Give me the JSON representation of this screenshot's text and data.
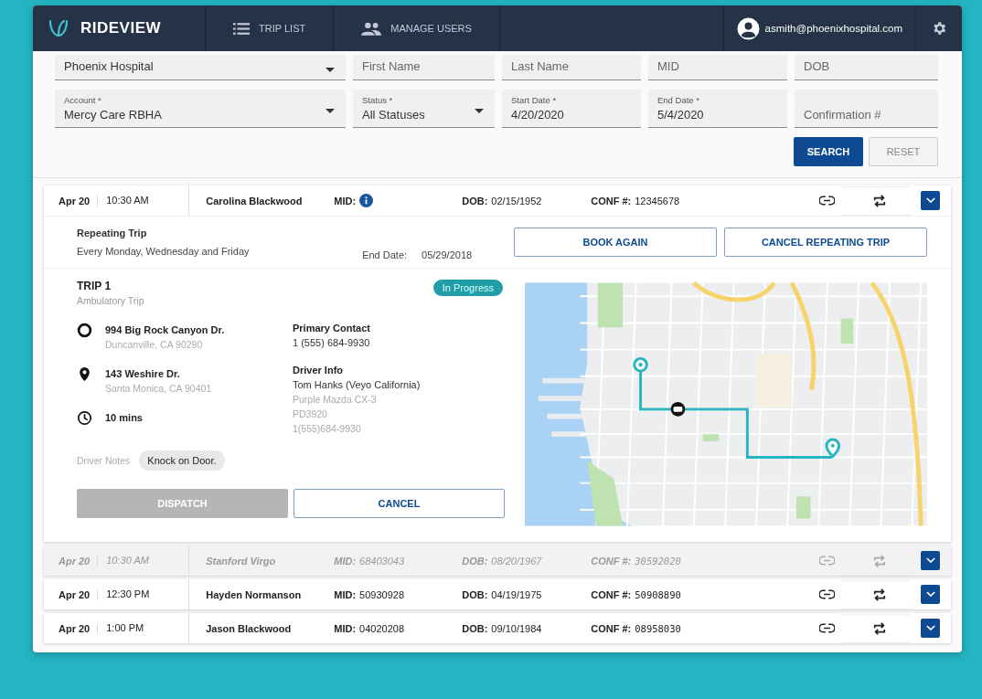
{
  "app": {
    "logo": "RIDEVIEW"
  },
  "nav": [
    {
      "label": "TRIP LIST"
    },
    {
      "label": "MANAGE USERS"
    }
  ],
  "user": {
    "email": "asmith@phoenixhospital.com"
  },
  "filters": [
    [
      {
        "kind": "select",
        "value": "Phoenix Hospital"
      },
      {
        "kind": "text",
        "placeholder": "First Name"
      },
      {
        "kind": "text",
        "placeholder": "Last Name"
      },
      {
        "kind": "text",
        "placeholder": "MID"
      },
      {
        "kind": "text",
        "placeholder": "DOB"
      }
    ],
    [
      {
        "kind": "select",
        "label": "Account *",
        "value": "Mercy Care RBHA"
      },
      {
        "kind": "select",
        "label": "Status *",
        "value": "All Statuses"
      },
      {
        "kind": "text",
        "label": "Start Date *",
        "value": "4/20/2020"
      },
      {
        "kind": "text",
        "label": "End Date *",
        "value": "5/4/2020"
      },
      {
        "kind": "text",
        "placeholder": "Confirmation #"
      }
    ]
  ],
  "filter_buttons": [
    {
      "label": "SEARCH",
      "disabled": false
    },
    {
      "label": "RESET",
      "disabled": true
    }
  ],
  "trips": [
    {
      "date": "Apr 20",
      "time": "10:30 AM",
      "name": "Carolina Blackwood",
      "disabled": false,
      "fields": [
        {
          "kind": "info",
          "label": "MID:"
        },
        {
          "kind": "text",
          "label": "DOB:",
          "value": "02/15/1952"
        },
        {
          "kind": "text",
          "label": "CONF #:",
          "value": "12345678"
        }
      ]
    },
    {
      "date": "Apr 20",
      "time": "10:30 AM",
      "name": "Stanford Virgo",
      "disabled": true,
      "fields": [
        {
          "kind": "text",
          "label": "MID:",
          "value": "68403043"
        },
        {
          "kind": "text",
          "label": "DOB:",
          "value": "08/20/1967"
        },
        {
          "kind": "code",
          "label": "CONF #:",
          "value": "30592020"
        }
      ]
    },
    {
      "date": "Apr 20",
      "time": "12:30 PM",
      "name": "Hayden Normanson",
      "disabled": false,
      "fields": [
        {
          "kind": "text",
          "label": "MID:",
          "value": "50930928"
        },
        {
          "kind": "text",
          "label": "DOB:",
          "value": "04/19/1975"
        },
        {
          "kind": "code",
          "label": "CONF #:",
          "value": "50908890"
        }
      ]
    },
    {
      "date": "Apr 20",
      "time": "1:00 PM",
      "name": "Jason Blackwood",
      "disabled": false,
      "fields": [
        {
          "kind": "text",
          "label": "MID:",
          "value": "04020208"
        },
        {
          "kind": "text",
          "label": "DOB:",
          "value": "09/10/1984"
        },
        {
          "kind": "code",
          "label": "CONF #:",
          "value": "08958030"
        }
      ]
    }
  ],
  "detail": {
    "repeating": {
      "title": "Repeating Trip",
      "schedule": "Every Monday, Wednesday and Friday",
      "end_label": "End Date:",
      "end_date": "05/29/2018",
      "actions": [
        "BOOK AGAIN",
        "CANCEL REPEATING TRIP"
      ]
    },
    "trip": {
      "title": "TRIP 1",
      "subtitle": "Ambulatory Trip",
      "status": "In Progress",
      "stops": [
        {
          "kind": "origin",
          "line1": "994 Big Rock Canyon Dr.",
          "line2": "Duncanville, CA 90290"
        },
        {
          "kind": "destination",
          "line1": "143 Weshire Dr.",
          "line2": "Santa Monica, CA 90401"
        },
        {
          "kind": "duration",
          "line1": "10 mins"
        }
      ],
      "contact": {
        "label": "Primary Contact",
        "name": "1 (555) 684-9930"
      },
      "driver": {
        "label": "Driver Info",
        "name": "Tom Hanks (Veyo California)",
        "lines": [
          "Purple Mazda CX-3",
          "PD3920",
          "1(555)684-9930"
        ]
      },
      "notes_label": "Driver Notes",
      "note": "Knock on Door.",
      "buttons": [
        {
          "label": "DISPATCH",
          "disabled": true
        },
        {
          "label": "CANCEL",
          "disabled": false
        }
      ]
    }
  }
}
